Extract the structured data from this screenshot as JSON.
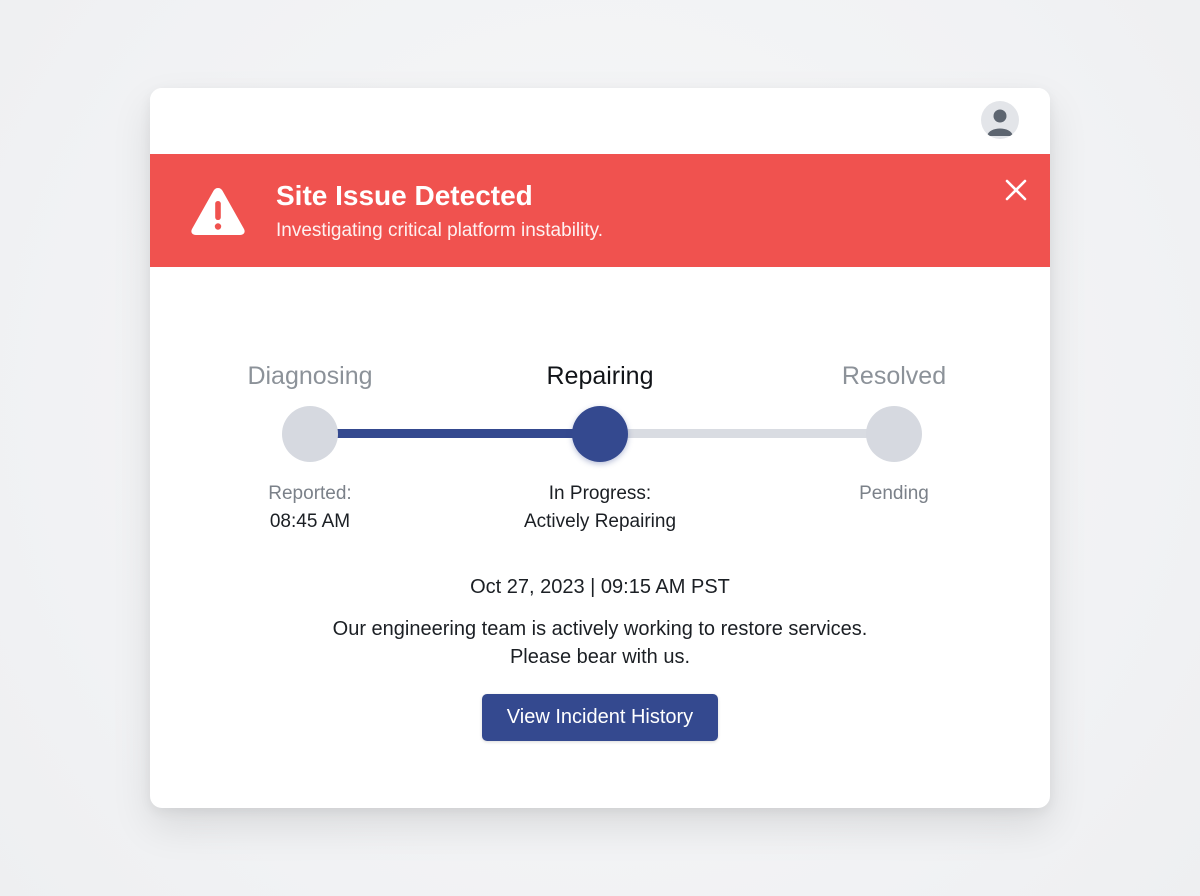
{
  "banner": {
    "title": "Site Issue Detected",
    "subtitle": "Investigating critical platform instability.",
    "icon": "warning-triangle-icon",
    "close_icon": "close-icon",
    "color": "#f0524f"
  },
  "header": {
    "avatar_icon": "user-avatar-icon"
  },
  "stepper": {
    "current_step": 2,
    "steps": [
      {
        "title": "Diagnosing",
        "detail_lines": [
          "Reported:",
          "08:45 AM"
        ],
        "state": "complete"
      },
      {
        "title": "Repairing",
        "detail_lines": [
          "In Progress:",
          "Actively Repairing"
        ],
        "state": "active"
      },
      {
        "title": "Resolved",
        "detail_lines": [
          "Pending"
        ],
        "state": "pending"
      }
    ],
    "active_color": "#34498f",
    "inactive_color": "#d9dce2"
  },
  "status": {
    "timestamp": "Oct 27, 2023 | 09:15 AM PST",
    "message_line1": "Our engineering team is actively working to restore services.",
    "message_line2": "Please bear with us."
  },
  "actions": {
    "history_label": "View Incident History"
  }
}
